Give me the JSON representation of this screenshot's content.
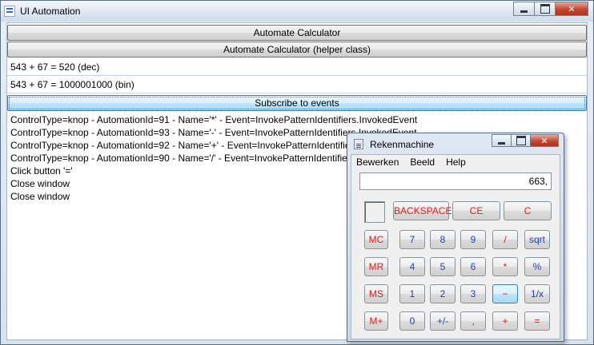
{
  "window": {
    "title": "UI Automation"
  },
  "buttons": {
    "automate": "Automate Calculator",
    "automate_helper": "Automate Calculator (helper class)",
    "subscribe": "Subscribe to events"
  },
  "results": {
    "dec": "543 + 67 = 520 (dec)",
    "bin": "543 + 67 = 1000001000  (bin)"
  },
  "log": [
    "ControlType=knop - AutomationId=91 - Name='*' - Event=InvokePatternIdentifiers.InvokedEvent",
    "ControlType=knop - AutomationId=93 - Name='-' - Event=InvokePatternIdentifiers.InvokedEvent",
    "ControlType=knop - AutomationId=92 - Name='+' - Event=InvokePatternIdentifiers.InvokedEvent",
    "ControlType=knop - AutomationId=90 - Name='/' - Event=InvokePatternIdentifiers.InvokedEvent",
    "Click button '='",
    "Close window",
    "Close window"
  ],
  "calculator": {
    "title": "Rekenmachine",
    "menu": [
      "Bewerken",
      "Beeld",
      "Help"
    ],
    "display": "663,",
    "top_keys": [
      "BACKSPACE",
      "CE",
      "C"
    ],
    "memory_keys": [
      "MC",
      "MR",
      "MS",
      "M+"
    ],
    "rows": [
      [
        "7",
        "8",
        "9",
        "/",
        "sqrt"
      ],
      [
        "4",
        "5",
        "6",
        "*",
        "%"
      ],
      [
        "1",
        "2",
        "3",
        "−",
        "1/x"
      ],
      [
        "0",
        "+/-",
        ",",
        "+",
        "="
      ]
    ]
  },
  "colors": {
    "operator": "#e21b1b",
    "digit": "#1f3fbf",
    "hover_accent": "#3c7fb1"
  }
}
